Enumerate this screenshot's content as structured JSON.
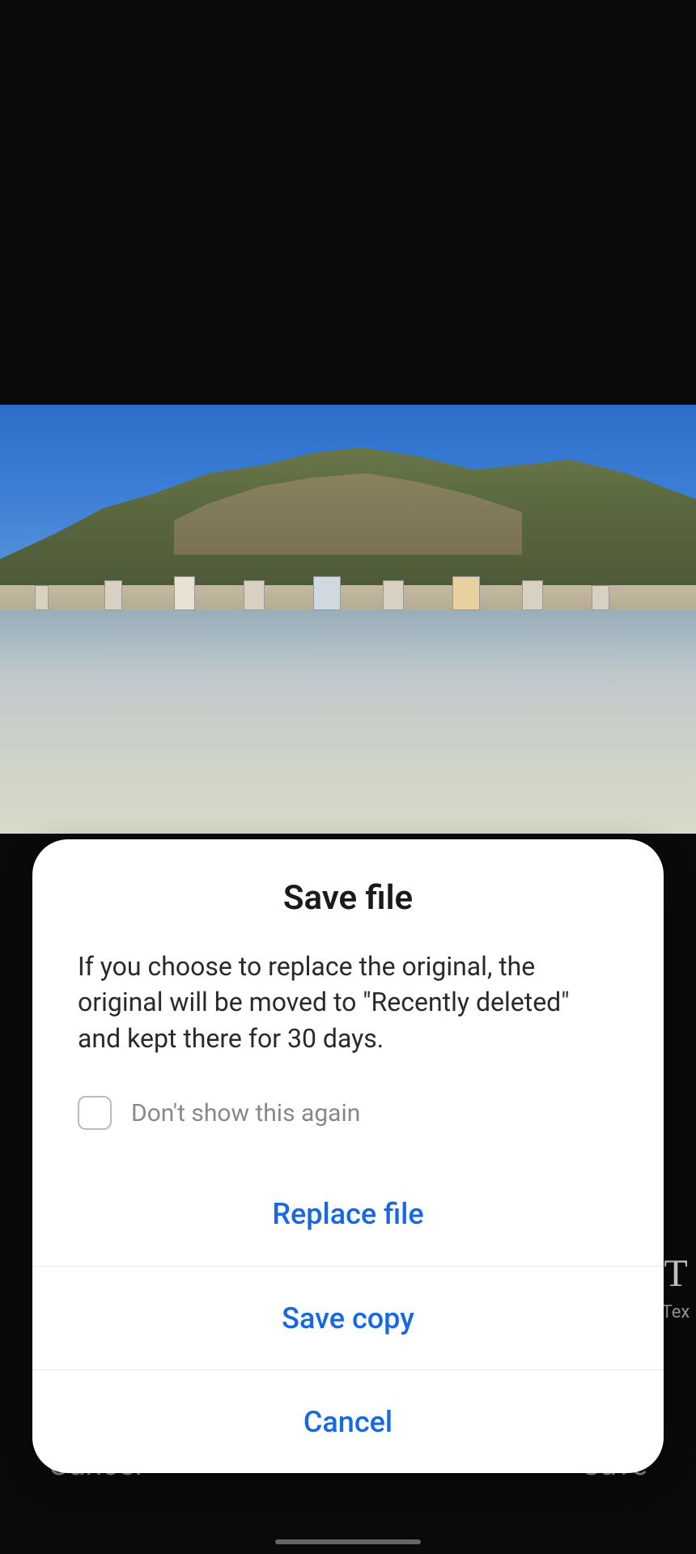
{
  "dialog": {
    "title": "Save file",
    "body": "If you choose to replace the original, the original will be moved to \"Recently deleted\" and kept there for 30 days.",
    "checkbox_label": "Don't show this again",
    "buttons": {
      "replace": "Replace file",
      "save_copy": "Save copy",
      "cancel": "Cancel"
    }
  },
  "editor_bar": {
    "cancel": "Cancel",
    "save": "Save"
  },
  "tool": {
    "text_label": "Tex"
  }
}
